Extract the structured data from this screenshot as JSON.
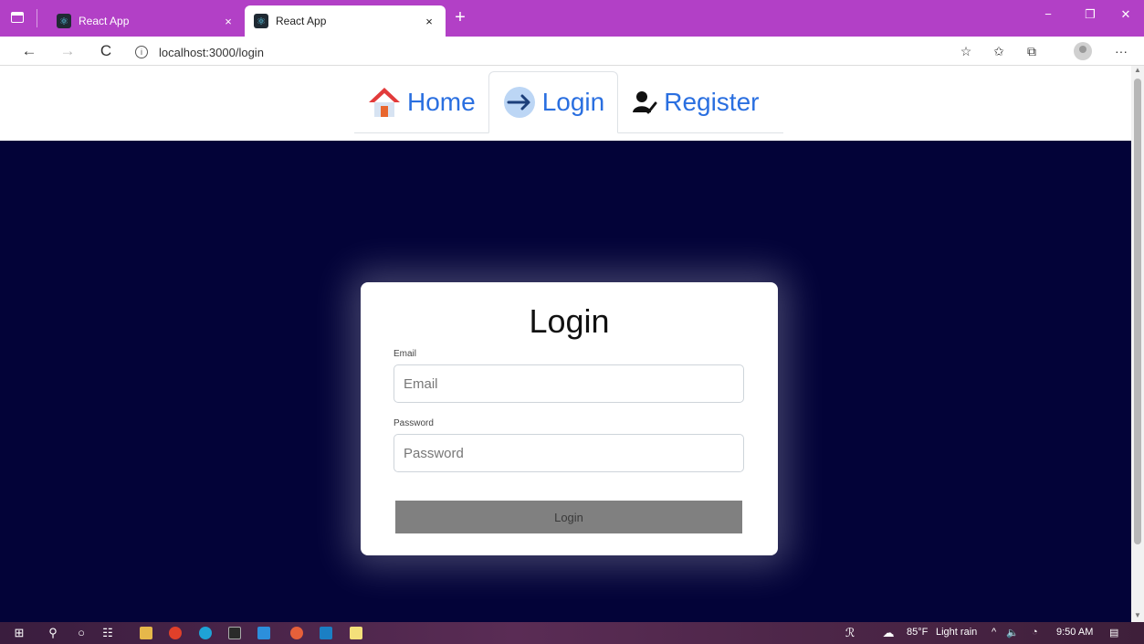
{
  "browser": {
    "tabs": [
      {
        "label": "React App",
        "active": false
      },
      {
        "label": "React App",
        "active": true
      }
    ],
    "tab_close": "×",
    "new_tab": "+",
    "window_controls": {
      "minimize": "−",
      "restore": "❐",
      "close": "✕"
    },
    "back": "←",
    "forward": "→",
    "reload": "C",
    "info": "i",
    "url": "localhost:3000/login",
    "toolbar_icons": {
      "favorites_add": "☆",
      "favorites": "✩",
      "collections": "⧉",
      "more": "···"
    }
  },
  "navbar": {
    "items": [
      {
        "label": "Home",
        "icon": "home-icon",
        "active": false
      },
      {
        "label": "Login",
        "icon": "login-arrow-icon",
        "active": true
      },
      {
        "label": "Register",
        "icon": "register-user-icon",
        "active": false
      }
    ]
  },
  "login_form": {
    "title": "Login",
    "email_label": "Email",
    "email_placeholder": "Email",
    "password_label": "Password",
    "password_placeholder": "Password",
    "submit_label": "Login"
  },
  "taskbar": {
    "weather_temp": "85°F",
    "weather_text": "Light rain",
    "time": "9:50 AM"
  },
  "colors": {
    "tab_bar": "#b240c6",
    "page_background": "#030338",
    "link_blue": "#2a6fe0",
    "button_gray": "#808080"
  }
}
